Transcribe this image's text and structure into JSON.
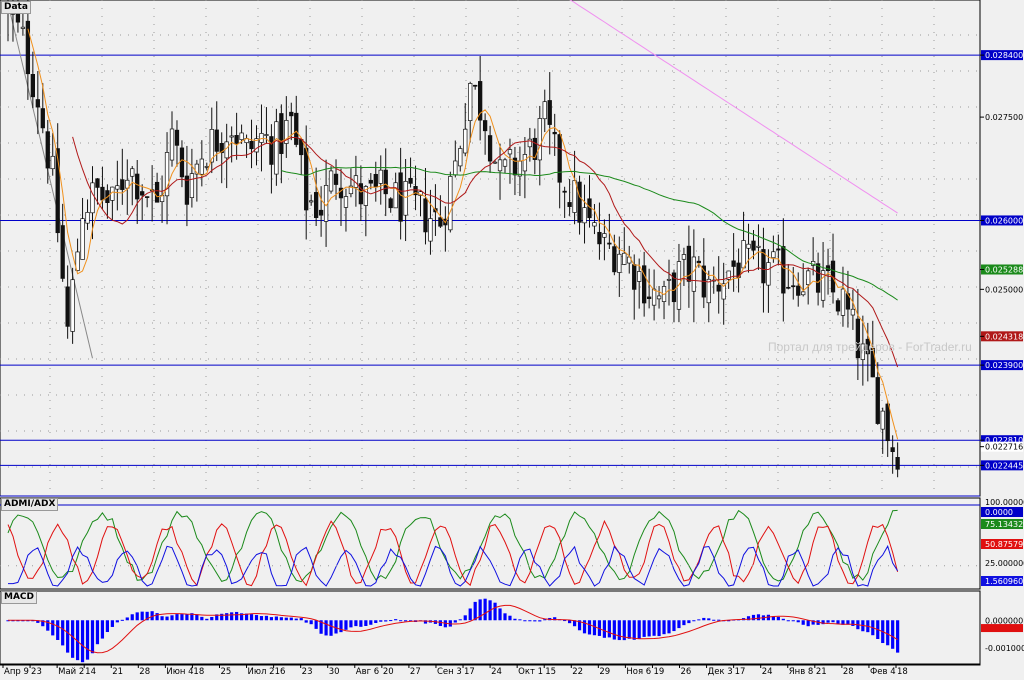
{
  "panels": {
    "main_label": "Data",
    "admi_label": "ADMI/ADX",
    "macd_label": "MACD"
  },
  "watermark": "Портал для трейдеров - ForTrader.ru",
  "colors": {
    "background": "#f0f0f0",
    "candles": "#111111",
    "sma_fast": "#f0901c",
    "sma_mid": "#b01818",
    "sma_slow": "#1b8a1b",
    "sma_long": "#f090f0",
    "hline": "#0000c8",
    "adx_plus": "#1b8a1b",
    "adx_minus": "#e01010",
    "adx_main": "#1010e0",
    "macd_hist": "#0000ff",
    "macd_signal": "#e01010"
  },
  "chart_data": [
    {
      "type": "candlestick",
      "panel": "main",
      "ylim": [
        0.022,
        0.0292
      ],
      "y_axis_labels": [
        "0.028400",
        "0.027500",
        "0.026000",
        "0.025288",
        "0.025000",
        "0.024318",
        "0.023900",
        "0.022810",
        "0.022716",
        "0.022445"
      ],
      "x_tick_labels": [
        "Апр 9",
        "23",
        "Май 2",
        "14",
        "21",
        "28",
        "Июн 4",
        "18",
        "25",
        "Июл 2",
        "16",
        "23",
        "30",
        "Авг 6",
        "20",
        "27",
        "Сен 3",
        "17",
        "24",
        "Окт 1",
        "15",
        "22",
        "29",
        "Ноя 6",
        "19",
        "26",
        "Дек 3",
        "17",
        "24",
        "Янв 8",
        "21",
        "28",
        "Фев 4",
        "18"
      ],
      "horizontal_levels": [
        0.0284,
        0.026,
        0.0239,
        0.02281,
        0.022445,
        0.022
      ],
      "close_anchors": [
        [
          0,
          0.029
        ],
        [
          3,
          0.0286
        ],
        [
          6,
          0.0278
        ],
        [
          9,
          0.0266
        ],
        [
          12,
          0.0244
        ],
        [
          15,
          0.0262
        ],
        [
          18,
          0.0264
        ],
        [
          21,
          0.0262
        ],
        [
          24,
          0.0268
        ],
        [
          27,
          0.0265
        ],
        [
          30,
          0.0262
        ],
        [
          33,
          0.0272
        ],
        [
          36,
          0.0265
        ],
        [
          39,
          0.027
        ],
        [
          42,
          0.0272
        ],
        [
          45,
          0.0274
        ],
        [
          48,
          0.027
        ],
        [
          51,
          0.0272
        ],
        [
          54,
          0.0271
        ],
        [
          57,
          0.0274
        ],
        [
          60,
          0.0263
        ],
        [
          63,
          0.0262
        ],
        [
          66,
          0.0267
        ],
        [
          69,
          0.0265
        ],
        [
          72,
          0.0263
        ],
        [
          75,
          0.0264
        ],
        [
          78,
          0.0263
        ],
        [
          81,
          0.0262
        ],
        [
          84,
          0.0261
        ],
        [
          87,
          0.026
        ],
        [
          90,
          0.0268
        ],
        [
          93,
          0.028
        ],
        [
          96,
          0.0275
        ],
        [
          99,
          0.0266
        ],
        [
          102,
          0.0268
        ],
        [
          105,
          0.027
        ],
        [
          108,
          0.0274
        ],
        [
          111,
          0.0267
        ],
        [
          114,
          0.0263
        ],
        [
          117,
          0.0259
        ],
        [
          120,
          0.0256
        ],
        [
          123,
          0.0256
        ],
        [
          126,
          0.0253
        ],
        [
          129,
          0.025
        ],
        [
          132,
          0.0248
        ],
        [
          135,
          0.0252
        ],
        [
          138,
          0.0253
        ],
        [
          141,
          0.025
        ],
        [
          144,
          0.0252
        ],
        [
          147,
          0.0254
        ],
        [
          150,
          0.0253
        ],
        [
          153,
          0.0253
        ],
        [
          156,
          0.0252
        ],
        [
          159,
          0.0252
        ],
        [
          162,
          0.0251
        ],
        [
          165,
          0.025
        ],
        [
          168,
          0.0248
        ],
        [
          171,
          0.0242
        ],
        [
          174,
          0.0236
        ],
        [
          176,
          0.0232
        ],
        [
          178,
          0.02272
        ]
      ],
      "series": [
        {
          "name": "SMA fast",
          "role": "sma_fast"
        },
        {
          "name": "SMA mid",
          "role": "sma_mid"
        },
        {
          "name": "SMA slow",
          "role": "sma_slow"
        },
        {
          "name": "SMA long",
          "role": "sma_long"
        }
      ]
    },
    {
      "type": "line",
      "panel": "admi",
      "ylim": [
        0,
        100
      ],
      "y_axis_labels": [
        "100.000000",
        "0.0000",
        "75.134320",
        "50.875792",
        "25.000000",
        "1.560960"
      ],
      "last_values": {
        "adx_plus": 75.13432,
        "adx_minus": 50.875792,
        "adx_main": 1.56096
      }
    },
    {
      "type": "bar",
      "panel": "macd",
      "ylim": [
        -0.0015,
        0.0008
      ],
      "y_axis_labels": [
        "0.000000",
        "-0.001000"
      ],
      "signal_last": -0.00028
    }
  ]
}
